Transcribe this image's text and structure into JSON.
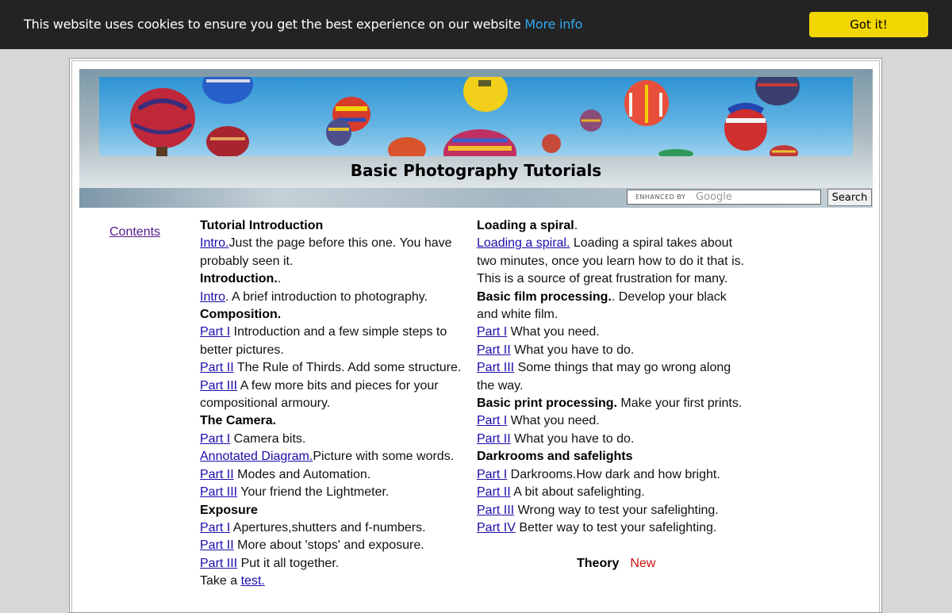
{
  "cookie": {
    "message": "This website uses cookies to ensure you get the best experience on our website",
    "more_info": "More info",
    "button": "Got it!"
  },
  "header": {
    "title": "Basic Photography Tutorials"
  },
  "search": {
    "enhanced_by": "ENHANCED BY",
    "google": "Google",
    "button": "Search"
  },
  "sidebar": {
    "contents_link": "Contents"
  },
  "col1": {
    "tutorial_intro_heading": "Tutorial Introduction",
    "intro1_link": "Intro.",
    "intro1_text_a": "Just the page before this one. You have",
    "intro1_text_b": "probably seen it.",
    "introduction_heading": "Introduction.",
    "introduction_heading_tail": ".",
    "intro2_link": "Intro",
    "intro2_text": ".  A brief introduction to photography.",
    "composition_heading": "Composition.",
    "comp_p1_link": "Part I",
    "comp_p1_text_a": " Introduction and a few simple steps to",
    "comp_p1_text_b": "better pictures.",
    "comp_p2_link": "Part II",
    "comp_p2_text": " The Rule of Thirds. Add some structure.",
    "comp_p3_link": "Part III",
    "comp_p3_text_a": "  A few more bits and pieces for your",
    "comp_p3_text_b": "compositional armoury.",
    "camera_heading": "The Camera.",
    "cam_p1_link": "Part I",
    "cam_p1_text": "  Camera bits.",
    "annotated_link": "Annotated Diagram.",
    "annotated_text": "Picture with some words.",
    "cam_p2_link": "Part II",
    "cam_p2_text": "  Modes and Automation.",
    "cam_p3_link": "Part III",
    "cam_p3_text": "  Your friend the Lightmeter.",
    "exposure_heading": "Exposure",
    "exp_p1_link": "Part I",
    "exp_p1_text": "  Apertures,shutters and f-numbers.",
    "exp_p2_link": "Part II",
    "exp_p2_text": "  More about 'stops' and exposure.",
    "exp_p3_link": "Part III",
    "exp_p3_text": "  Put it all together.",
    "take_a": "Take a ",
    "test_link": "test."
  },
  "col2": {
    "spiral_heading": "Loading a spiral",
    "spiral_heading_tail": ".",
    "spiral_link": "Loading a spiral.",
    "spiral_text_a": "  Loading a spiral takes about",
    "spiral_text_b": "two minutes, once you learn how to do it that is.",
    "spiral_text_c": "This is a source of great frustration for many.",
    "film_heading": "Basic film processing.",
    "film_text_a": ".  Develop your black",
    "film_text_b": "and white film.",
    "film_p1_link": "Part I",
    "film_p1_text": "   What you need.",
    "film_p2_link": "Part II",
    "film_p2_text": "  What you have to do.",
    "film_p3_link": "Part III",
    "film_p3_text_a": "  Some things that may go wrong along",
    "film_p3_text_b": "the way.",
    "print_heading": "Basic print processing.",
    "print_text": "  Make your first prints.",
    "print_p1_link": "Part I",
    "print_p1_text": "  What you need.",
    "print_p2_link": "Part II",
    "print_p2_text": "  What you have to do.",
    "dark_heading": "Darkrooms and safelights",
    "dark_p1_link": "Part I",
    "dark_p1_text": "  Darkrooms.How dark and how bright.",
    "dark_p2_link": "Part II",
    "dark_p2_text": "  A bit about safelighting.",
    "dark_p3_link": "Part III",
    "dark_p3_text": "  Wrong way to test your safelighting.",
    "dark_p4_link": "Part IV",
    "dark_p4_text": "  Better way to test your safelighting."
  },
  "theory": {
    "label": "Theory",
    "new": "New"
  },
  "colors": {
    "cookie_bg": "#232323",
    "cookie_button": "#f1d600",
    "more_info": "#31a8f0",
    "link": "#1a0dab",
    "visited_link": "#551a8b",
    "new_badge": "#d01010"
  }
}
